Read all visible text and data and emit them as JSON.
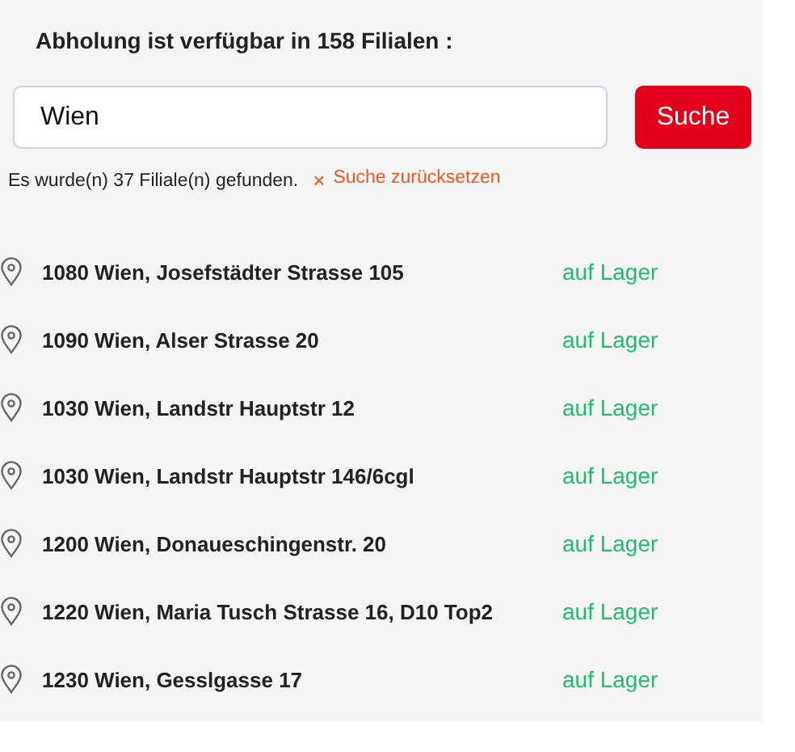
{
  "heading": "Abholung ist verfügbar in 158 Filialen :",
  "search": {
    "value": "Wien",
    "button": "Suche"
  },
  "result": {
    "text": "Es wurde(n) 37 Filiale(n) gefunden.",
    "reset_icon": "×",
    "reset": "Suche zurücksetzen"
  },
  "stores": [
    {
      "address": "1080 Wien, Josefstädter Strasse 105",
      "stock": "auf Lager"
    },
    {
      "address": "1090 Wien, Alser Strasse 20",
      "stock": "auf Lager"
    },
    {
      "address": "1030 Wien, Landstr Hauptstr 12",
      "stock": "auf Lager"
    },
    {
      "address": "1030 Wien, Landstr Hauptstr 146/6cgl",
      "stock": "auf Lager"
    },
    {
      "address": "1200 Wien, Donaueschingenstr. 20",
      "stock": "auf Lager"
    },
    {
      "address": "1220 Wien, Maria Tusch Strasse 16, D10 Top2",
      "stock": "auf Lager"
    },
    {
      "address": "1230 Wien, Gesslgasse 17",
      "stock": "auf Lager"
    }
  ]
}
